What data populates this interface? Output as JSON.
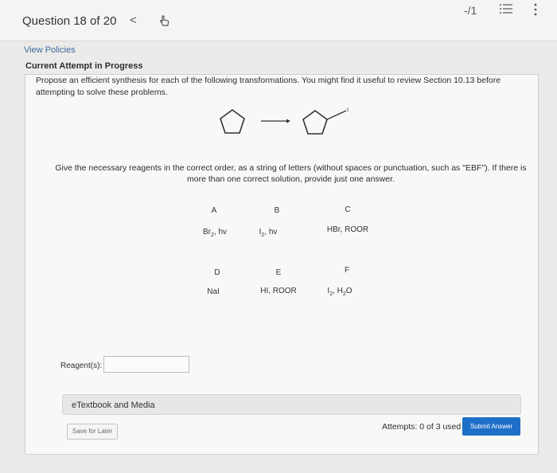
{
  "header": {
    "question_title": "Question 18 of 20",
    "prev_glyph": "<",
    "score": "-/1",
    "icons": [
      "hand-pointer-icon",
      "list-icon",
      "more-vertical-icon"
    ]
  },
  "view_policies": "View Policies",
  "attempt_status": "Current Attempt in Progress",
  "prompt": "Propose an efficient synthesis for each of the following transformations. You might find it useful to review Section 10.13 before attempting to solve these problems.",
  "reaction": {
    "start": "cyclopentane",
    "product": "iodocyclopentane",
    "product_label": "I"
  },
  "instruction": "Give the necessary reagents in the correct order, as a string of letters (without spaces or punctuation, such as \"EBF\"). If there is more than one correct solution, provide just one answer.",
  "options": [
    {
      "letter": "A",
      "reagent": "Br",
      "sub": "2",
      "suffix": ", hv"
    },
    {
      "letter": "B",
      "reagent": "I",
      "sub": "2",
      "suffix": ", hv"
    },
    {
      "letter": "C",
      "reagent": "HBr, ROOR",
      "sub": "",
      "suffix": ""
    },
    {
      "letter": "D",
      "reagent": "NaI",
      "sub": "",
      "suffix": ""
    },
    {
      "letter": "E",
      "reagent": "HI, ROOR",
      "sub": "",
      "suffix": ""
    },
    {
      "letter": "F",
      "reagent": "I",
      "sub": "2",
      "suffix": ", H",
      "sub2": "2",
      "suffix2": "O"
    }
  ],
  "reagent_field": {
    "label": "Reagent(s):",
    "value": "",
    "placeholder": ""
  },
  "etextbook_label": "eTextbook and Media",
  "save_label": "Save for Later",
  "attempts_text": "Attempts: 0 of 3 used",
  "submit_label": "Submit Answer",
  "colors": {
    "accent": "#1e6fc7",
    "link": "#3a6aa0"
  }
}
